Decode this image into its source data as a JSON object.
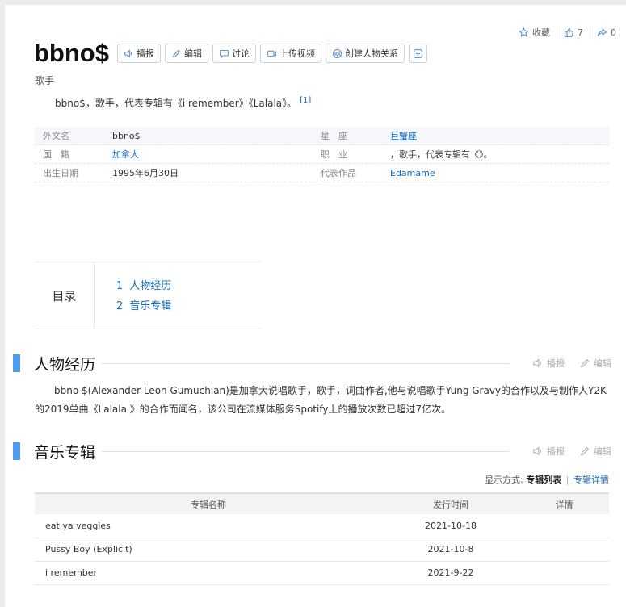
{
  "top_actions": {
    "favorite_label": "收藏",
    "like_count": "7",
    "share_count": "0"
  },
  "header": {
    "title": "bbno$",
    "buttons": {
      "report": "播报",
      "edit": "编辑",
      "discuss": "讨论",
      "upload_video": "上传视频",
      "create_relation": "创建人物关系"
    },
    "subtitle": "歌手"
  },
  "summary": {
    "text": "bbno$，歌手，代表专辑有《i remember》《Lalala》。",
    "ref": "[1]"
  },
  "info": {
    "rows": [
      {
        "k": "外文名",
        "v": "bbno$",
        "k2": "星　座",
        "v2": "巨蟹座"
      },
      {
        "k": "国　籍",
        "v": "加拿大",
        "k2": "职　业",
        "v2": "，歌手，代表专辑有《》。"
      },
      {
        "k": "出生日期",
        "v": "1995年6月30日",
        "k2": "代表作品",
        "v2": "Edamame"
      }
    ]
  },
  "toc": {
    "label": "目录",
    "items": [
      {
        "num": "1",
        "label": "人物经历"
      },
      {
        "num": "2",
        "label": "音乐专辑"
      }
    ]
  },
  "section_biography": {
    "title": "人物经历",
    "report": "播报",
    "edit": "编辑",
    "text": "bbno $(Alexander Leon Gumuchian)是加拿大说唱歌手，歌手，词曲作者,他与说唱歌手Yung Gravy的合作以及与制作人Y2K的2019单曲《Lalala 》的合作而闻名，该公司在流媒体服务Spotify上的播放次数已超过7亿次。"
  },
  "section_albums": {
    "title": "音乐专辑",
    "report": "播报",
    "edit": "编辑",
    "display_mode_label": "显示方式:",
    "mode_list": "专辑列表",
    "mode_pipe": "|",
    "mode_detail": "专辑详情",
    "columns": [
      "专辑名称",
      "发行时间",
      "详情"
    ],
    "rows": [
      {
        "name": "eat ya veggies",
        "date": "2021-10-18"
      },
      {
        "name": "Pussy Boy (Explicit)",
        "date": "2021-10-8"
      },
      {
        "name": "i remember",
        "date": "2021-9-22"
      }
    ]
  },
  "colors": {
    "accent_blue": "#136ec2",
    "section_bar": "#4f9cee"
  }
}
